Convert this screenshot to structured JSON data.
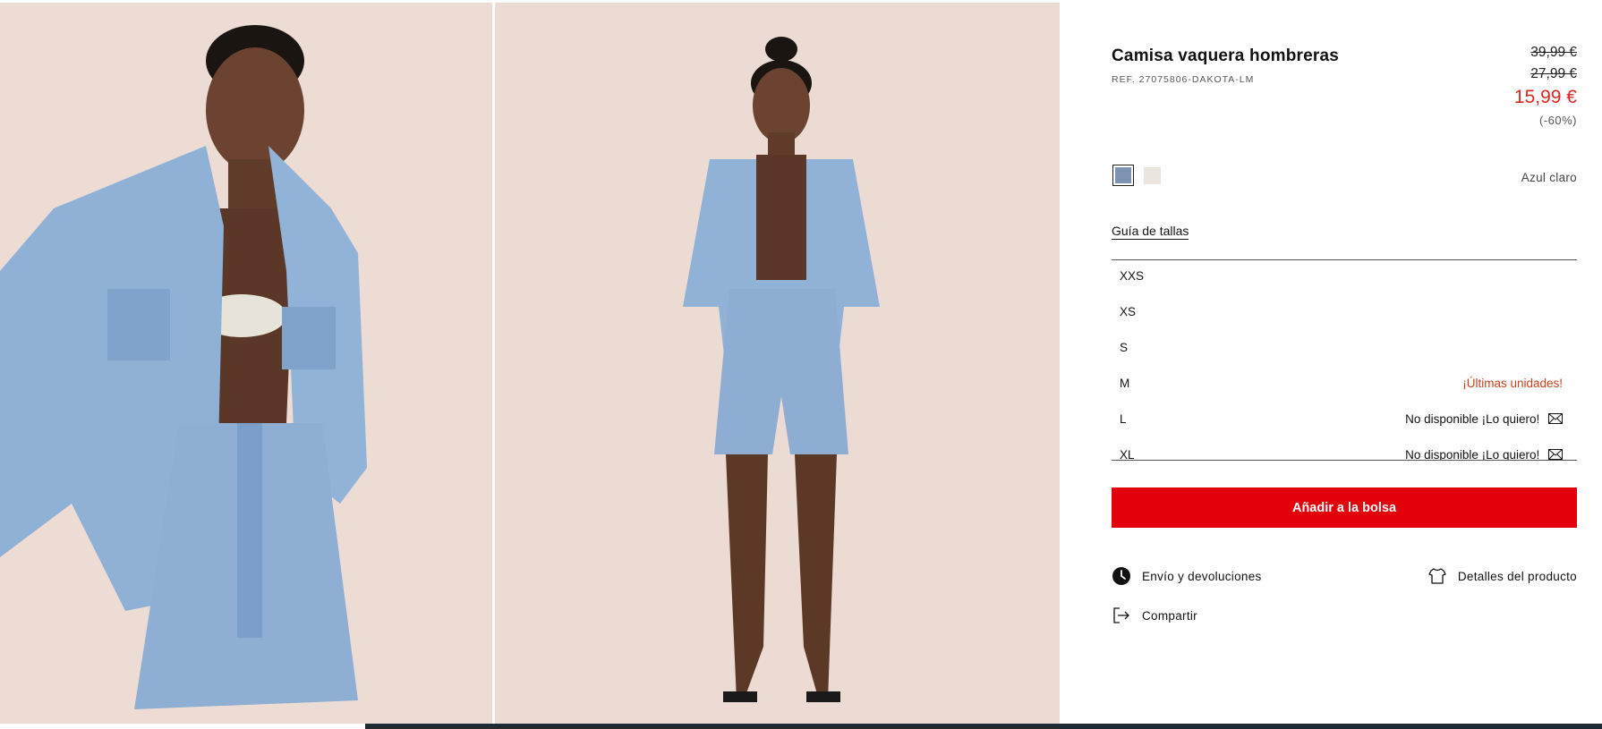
{
  "product": {
    "title": "Camisa vaquera hombreras",
    "ref": "REF. 27075806-DAKOTA-LM",
    "price_original_1": "39,99 €",
    "price_original_2": "27,99 €",
    "price_current": "15,99 €",
    "discount": "(-60%)"
  },
  "colors": {
    "selected_name": "Azul claro",
    "swatches": [
      {
        "name": "light-blue",
        "hex": "#7d93b4",
        "selected": true
      },
      {
        "name": "off-white",
        "hex": "#ebe5df",
        "selected": false
      }
    ]
  },
  "size_guide_label": "Guía de tallas",
  "sizes": [
    {
      "label": "XXS",
      "status": ""
    },
    {
      "label": "XS",
      "status": ""
    },
    {
      "label": "S",
      "status": ""
    },
    {
      "label": "M",
      "status": "¡Últimas unidades!"
    },
    {
      "label": "L",
      "status": "No disponible ¡Lo quiero!"
    },
    {
      "label": "XL",
      "status": "No disponible ¡Lo quiero!"
    }
  ],
  "add_to_bag_label": "Añadir a la bolsa",
  "links": {
    "shipping": "Envío y devoluciones",
    "details": "Detalles del producto",
    "share": "Compartir"
  },
  "theme": {
    "accent": "#e3000b",
    "sale_price": "#e0261f",
    "low_stock": "#c8411d",
    "photo_bg": "#ecdcd3"
  },
  "icons": {
    "shipping": "clock-icon",
    "details": "tshirt-icon",
    "share": "share-icon",
    "notify": "mail-icon"
  }
}
